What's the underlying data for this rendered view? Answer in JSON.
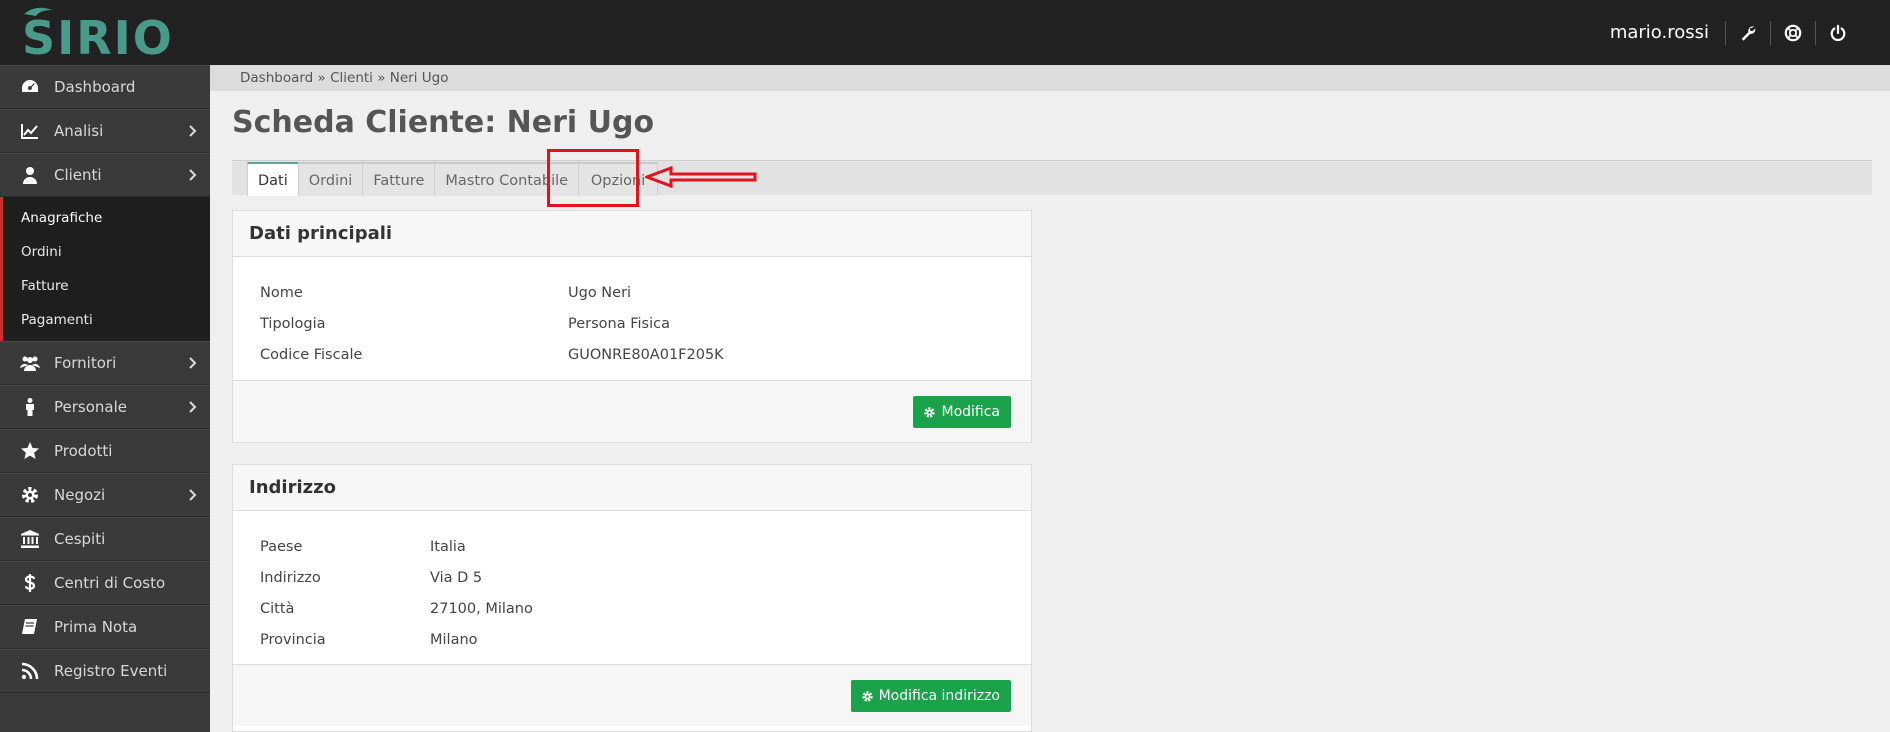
{
  "app": {
    "logo_text": "SIRIO",
    "username": "mario.rossi"
  },
  "topbar_icons": [
    "wrench-icon",
    "lifebuoy-icon",
    "power-icon"
  ],
  "sidebar": {
    "items": [
      {
        "label": "Dashboard",
        "icon": "dashboard-icon",
        "chevron": false
      },
      {
        "label": "Analisi",
        "icon": "line-chart-icon",
        "chevron": true
      },
      {
        "label": "Clienti",
        "icon": "user-icon",
        "chevron": true
      },
      {
        "label": "Fornitori",
        "icon": "users-icon",
        "chevron": true
      },
      {
        "label": "Personale",
        "icon": "person-icon",
        "chevron": true
      },
      {
        "label": "Prodotti",
        "icon": "star-icon",
        "chevron": false
      },
      {
        "label": "Negozi",
        "icon": "gear-icon",
        "chevron": true
      },
      {
        "label": "Cespiti",
        "icon": "bank-icon",
        "chevron": false
      },
      {
        "label": "Centri di Costo",
        "icon": "dollar-icon",
        "chevron": false
      },
      {
        "label": "Prima Nota",
        "icon": "book-icon",
        "chevron": false
      },
      {
        "label": "Registro Eventi",
        "icon": "rss-icon",
        "chevron": false
      }
    ],
    "clienti_submenu": [
      "Anagrafiche",
      "Ordini",
      "Fatture",
      "Pagamenti"
    ]
  },
  "breadcrumb": "Dashboard » Clienti » Neri Ugo",
  "page_title": "Scheda Cliente: Neri Ugo",
  "tabs": [
    "Dati",
    "Ordini",
    "Fatture",
    "Mastro Contabile",
    "Opzioni"
  ],
  "active_tab": "Dati",
  "dati_principali": {
    "title": "Dati principali",
    "rows": [
      {
        "label": "Nome",
        "value": "Ugo Neri"
      },
      {
        "label": "Tipologia",
        "value": "Persona Fisica"
      },
      {
        "label": "Codice Fiscale",
        "value": "GUONRE80A01F205K"
      }
    ],
    "button": "Modifica"
  },
  "indirizzo": {
    "title": "Indirizzo",
    "rows": [
      {
        "label": "Paese",
        "value": "Italia"
      },
      {
        "label": "Indirizzo",
        "value": "Via D 5"
      },
      {
        "label": "Città",
        "value": "27100, Milano"
      },
      {
        "label": "Provincia",
        "value": "Milano"
      }
    ],
    "button": "Modifica indirizzo"
  },
  "colors": {
    "accent": "#5fa39a",
    "button": "#1aa34a",
    "highlight": "#e0141e",
    "logo": "#4a9a8c"
  }
}
